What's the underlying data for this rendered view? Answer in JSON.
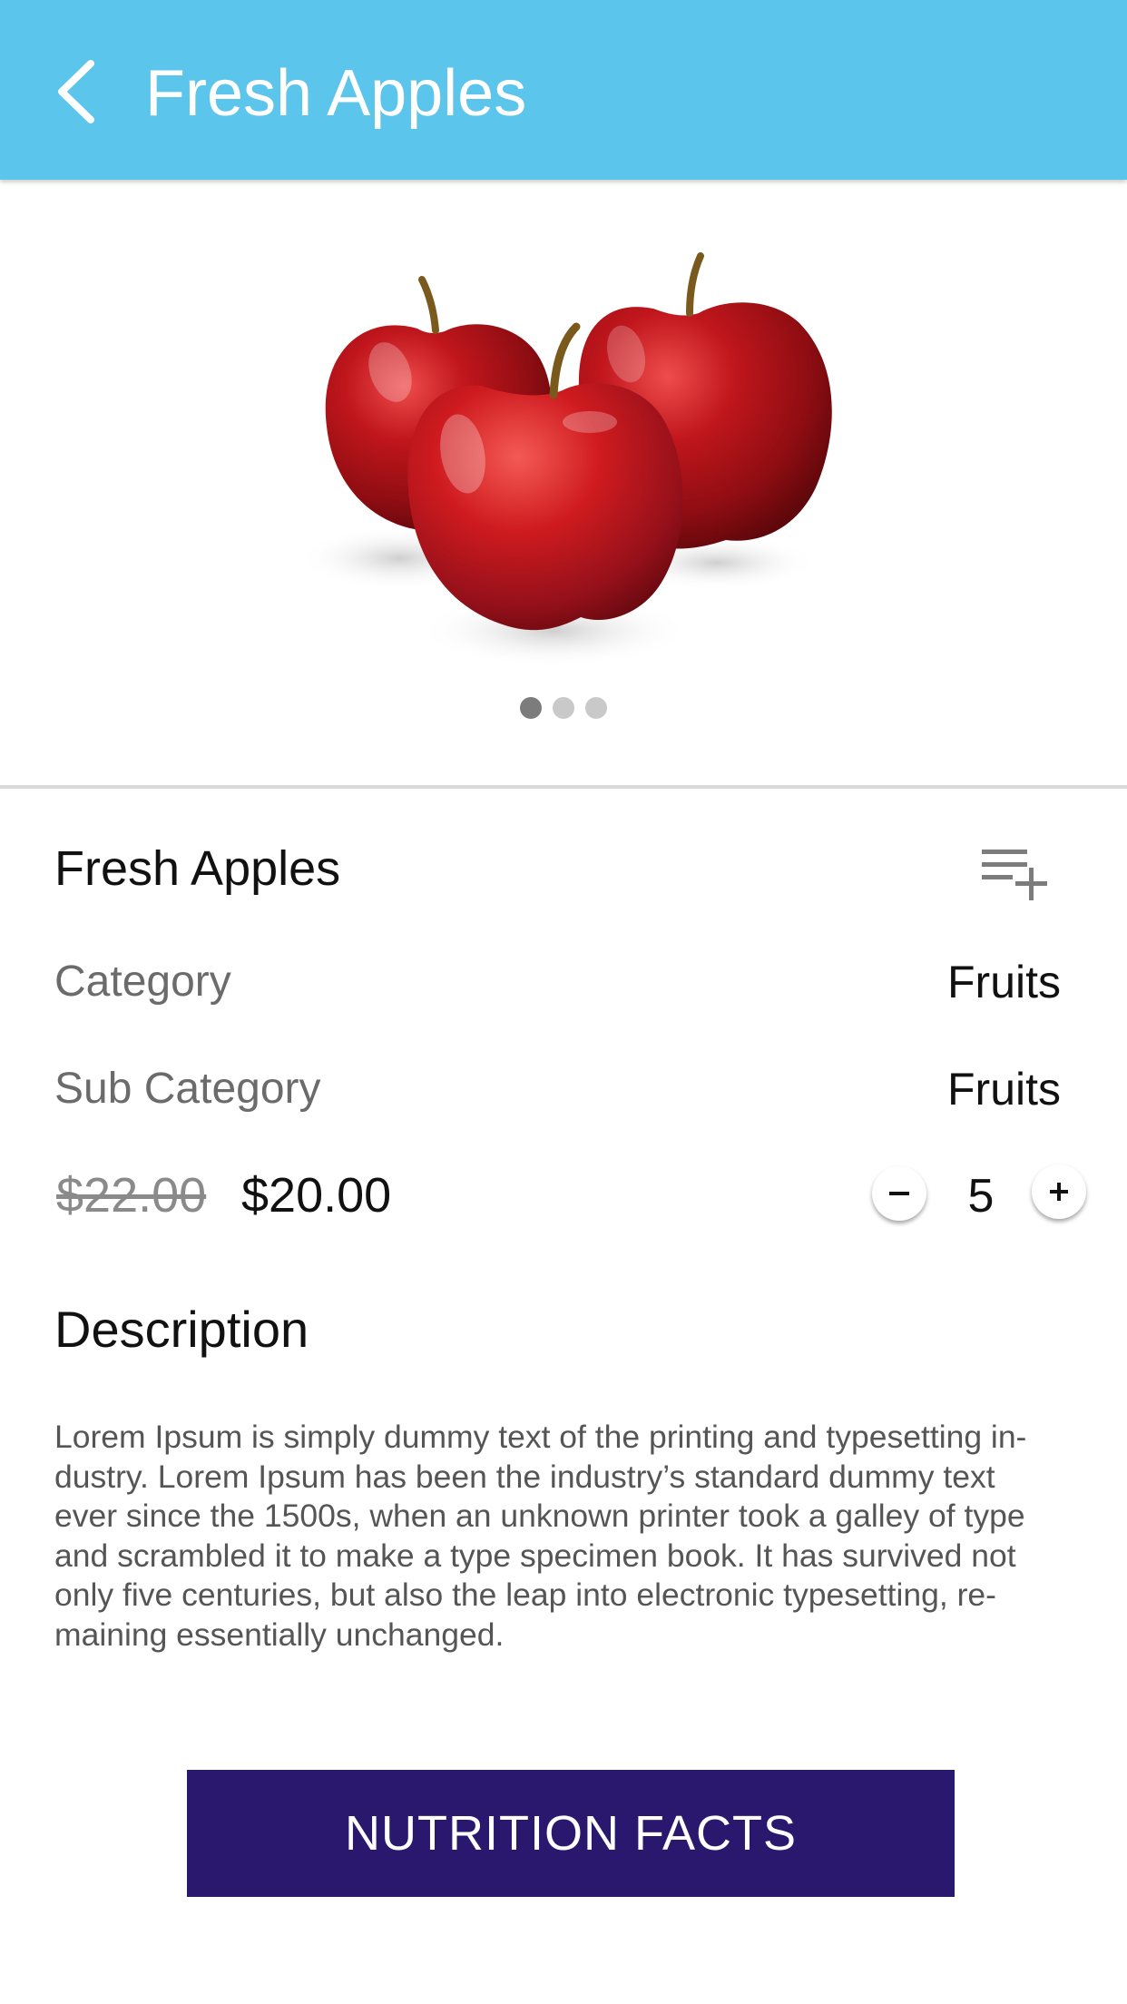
{
  "header": {
    "title": "Fresh Apples",
    "back_icon": "chevron-left-icon",
    "background_color": "#5bc5ec"
  },
  "carousel": {
    "image_subject": "three red apples",
    "page_count": 3,
    "active_index": 0
  },
  "product": {
    "name": "Fresh Apples",
    "add_to_list_icon": "playlist-add-icon",
    "details": [
      {
        "label": "Category",
        "value": "Fruits"
      },
      {
        "label": "Sub Category",
        "value": "Fruits"
      }
    ],
    "original_price": "$22.00",
    "price": "$20.00",
    "quantity": "5"
  },
  "description": {
    "heading": "Description",
    "lines": [
      "Lorem Ipsum is simply dummy text of the printing and typesetting in-",
      "dustry. Lorem Ipsum has been the industry’s standard dummy text",
      "ever since the 1500s, when an unknown printer took a galley of type",
      "and scrambled it to make a type specimen book. It has survived not",
      "only five centuries, but also the leap into electronic typesetting, re-",
      "maining essentially unchanged."
    ]
  },
  "cta": {
    "label": "NUTRITION FACTS",
    "background_color": "#2a186f"
  }
}
